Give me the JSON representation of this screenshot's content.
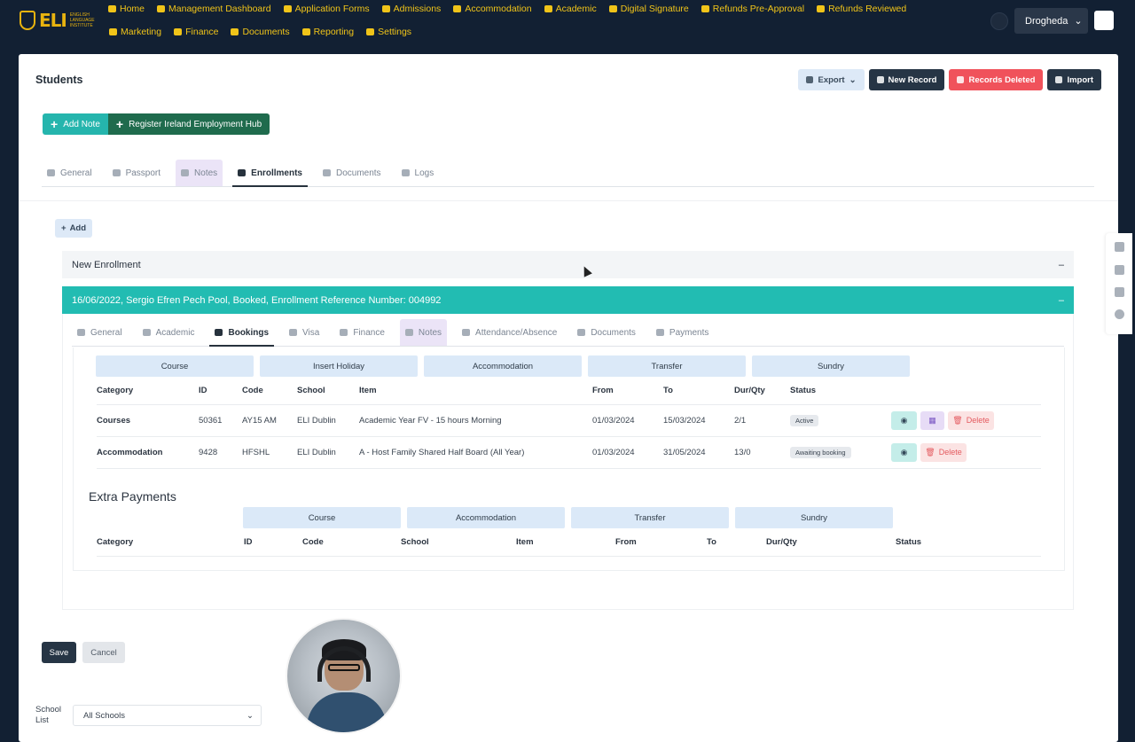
{
  "nav": {
    "logo": "ELI",
    "logo_sub": "ENGLISH LANGUAGE INSTITUTE",
    "row1": [
      {
        "label": "Home",
        "icon": "home-icon"
      },
      {
        "label": "Management Dashboard",
        "icon": "dashboard-icon"
      },
      {
        "label": "Application Forms",
        "icon": "form-icon"
      },
      {
        "label": "Admissions",
        "icon": "user-icon"
      },
      {
        "label": "Accommodation",
        "icon": "bed-icon"
      },
      {
        "label": "Academic",
        "icon": "academic-icon"
      },
      {
        "label": "Digital Signature",
        "icon": "signature-icon"
      },
      {
        "label": "Refunds Pre-Approval",
        "icon": "money-icon"
      },
      {
        "label": "Refunds Reviewed",
        "icon": "money-icon"
      }
    ],
    "row2": [
      {
        "label": "Marketing",
        "icon": "flag-icon"
      },
      {
        "label": "Finance",
        "icon": "chart-icon"
      },
      {
        "label": "Documents",
        "icon": "document-icon"
      },
      {
        "label": "Reporting",
        "icon": "report-icon"
      },
      {
        "label": "Settings",
        "icon": "settings-icon"
      }
    ],
    "location": "Drogheda"
  },
  "page": {
    "title": "Students",
    "actions": {
      "export": "Export",
      "new_record": "New Record",
      "records_deleted": "Records Deleted",
      "import": "Import"
    },
    "add_note": "Add Note",
    "register_hub": "Register Ireland Employment Hub",
    "tabs": [
      "General",
      "Passport",
      "Notes",
      "Enrollments",
      "Documents",
      "Logs"
    ],
    "add": "Add"
  },
  "enrollments": {
    "new_title": "New Enrollment",
    "current_title": "16/06/2022, Sergio Efren Pech Pool, Booked, Enrollment Reference Number: 004992",
    "tabs": [
      "General",
      "Academic",
      "Bookings",
      "Visa",
      "Finance",
      "Notes",
      "Attendance/Absence",
      "Documents",
      "Payments"
    ],
    "booking_buttons": [
      "Course",
      "Insert Holiday",
      "Accommodation",
      "Transfer",
      "Sundry"
    ],
    "columns": [
      "Category",
      "ID",
      "Code",
      "School",
      "Item",
      "From",
      "To",
      "Dur/Qty",
      "Status"
    ],
    "rows": [
      {
        "category": "Courses",
        "id": "50361",
        "code": "AY15 AM",
        "school": "ELI Dublin",
        "item": "Academic Year FV - 15 hours Morning",
        "from": "01/03/2024",
        "to": "15/03/2024",
        "dur": "2/1",
        "status": "Active"
      },
      {
        "category": "Accommodation",
        "id": "9428",
        "code": "HFSHL",
        "school": "ELI Dublin",
        "item": "A - Host Family Shared Half Board (All Year)",
        "from": "01/03/2024",
        "to": "31/05/2024",
        "dur": "13/0",
        "status": "Awaiting booking"
      }
    ],
    "delete_label": "Delete",
    "extra": {
      "title": "Extra Payments",
      "buttons": [
        "Course",
        "Accommodation",
        "Transfer",
        "Sundry"
      ],
      "columns": [
        "Category",
        "ID",
        "Code",
        "School",
        "Item",
        "From",
        "To",
        "Dur/Qty",
        "Status"
      ]
    }
  },
  "footer": {
    "save": "Save",
    "cancel": "Cancel",
    "school_label": "School List",
    "school_value": "All Schools"
  },
  "colors": {
    "nav_bg": "#122033",
    "accent_yellow": "#f0c419",
    "teal": "#22bcb2",
    "red": "#f0525b",
    "dark": "#263545"
  }
}
